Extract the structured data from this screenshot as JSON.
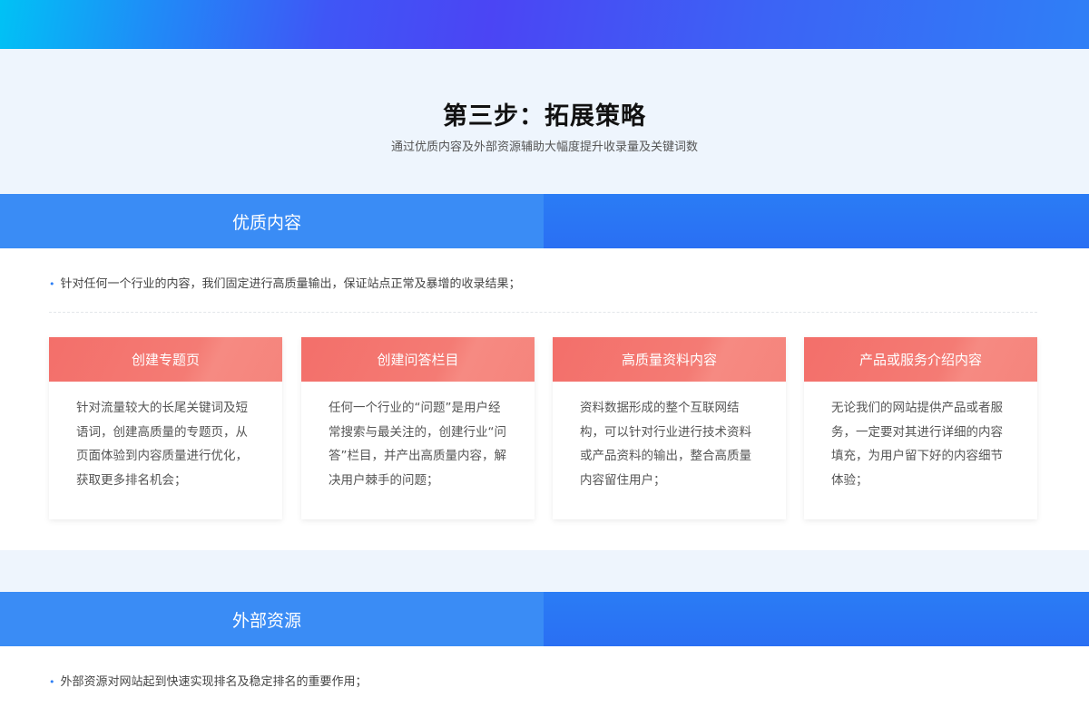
{
  "header": {
    "title": "第三步：拓展策略",
    "subtitle": "通过优质内容及外部资源辅助大幅度提升收录量及关键词数"
  },
  "sections": [
    {
      "title": "优质内容",
      "bullet": "针对任何一个行业的内容，我们固定进行高质量输出，保证站点正常及暴增的收录结果；",
      "cards": [
        {
          "title": "创建专题页",
          "text": "针对流量较大的长尾关键词及短语词，创建高质量的专题页，从页面体验到内容质量进行优化，获取更多排名机会；"
        },
        {
          "title": "创建问答栏目",
          "text": "任何一个行业的“问题”是用户经常搜索与最关注的，创建行业“问答”栏目，并产出高质量内容，解决用户棘手的问题；"
        },
        {
          "title": "高质量资料内容",
          "text": "资料数据形成的整个互联网结构，可以针对行业进行技术资料或产品资料的输出，整合高质量内容留住用户；"
        },
        {
          "title": "产品或服务介绍内容",
          "text": "无论我们的网站提供产品或者服务，一定要对其进行详细的内容填充，为用户留下好的内容细节体验；"
        }
      ]
    },
    {
      "title": "外部资源",
      "bullet": "外部资源对网站起到快速实现排名及稳定排名的重要作用；"
    }
  ],
  "colors": {
    "accent_blue": "#3a8cf5",
    "card_header_red": "#f36f6a"
  }
}
